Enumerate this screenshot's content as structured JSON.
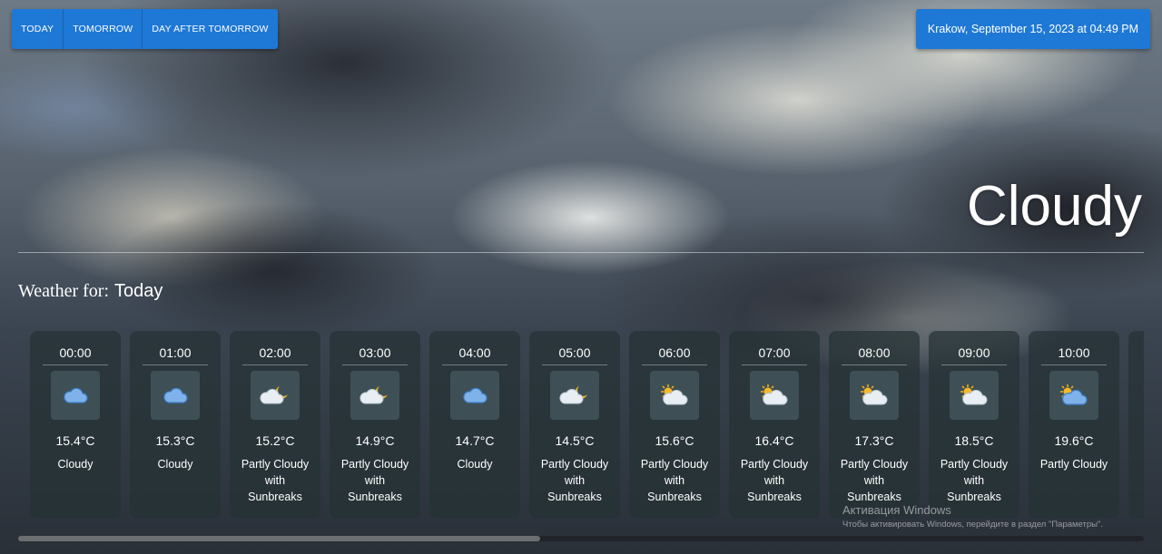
{
  "tabs": [
    "TODAY",
    "TOMORROW",
    "DAY AFTER TOMORROW"
  ],
  "location_datetime": "Krakow, September 15, 2023 at 04:49 PM",
  "current_condition": "Cloudy",
  "weather_for": {
    "label": "Weather for:",
    "day": "Today"
  },
  "hours": [
    {
      "time": "00:00",
      "icon": "cloud-icon",
      "temp": "15.4°C",
      "desc": "Cloudy"
    },
    {
      "time": "01:00",
      "icon": "cloud-icon",
      "temp": "15.3°C",
      "desc": "Cloudy"
    },
    {
      "time": "02:00",
      "icon": "cloud-moon-icon",
      "temp": "15.2°C",
      "desc": "Partly Cloudy with Sunbreaks"
    },
    {
      "time": "03:00",
      "icon": "cloud-moon-icon",
      "temp": "14.9°C",
      "desc": "Partly Cloudy with Sunbreaks"
    },
    {
      "time": "04:00",
      "icon": "cloud-icon",
      "temp": "14.7°C",
      "desc": "Cloudy"
    },
    {
      "time": "05:00",
      "icon": "cloud-moon-icon",
      "temp": "14.5°C",
      "desc": "Partly Cloudy with Sunbreaks"
    },
    {
      "time": "06:00",
      "icon": "sun-cloud-icon",
      "temp": "15.6°C",
      "desc": "Partly Cloudy with Sunbreaks"
    },
    {
      "time": "07:00",
      "icon": "sun-cloud-icon",
      "temp": "16.4°C",
      "desc": "Partly Cloudy with Sunbreaks"
    },
    {
      "time": "08:00",
      "icon": "sun-cloud-icon",
      "temp": "17.3°C",
      "desc": "Partly Cloudy with Sunbreaks"
    },
    {
      "time": "09:00",
      "icon": "sun-cloud-icon",
      "temp": "18.5°C",
      "desc": "Partly Cloudy with Sunbreaks"
    },
    {
      "time": "10:00",
      "icon": "sun-blue-cloud-icon",
      "temp": "19.6°C",
      "desc": "Partly Cloudy"
    }
  ],
  "watermark": {
    "title": "Активация Windows",
    "subtitle": "Чтобы активировать Windows, перейдите в раздел \"Параметры\"."
  },
  "colors": {
    "accent": "#1e78d6",
    "card_bg": "#263234"
  }
}
